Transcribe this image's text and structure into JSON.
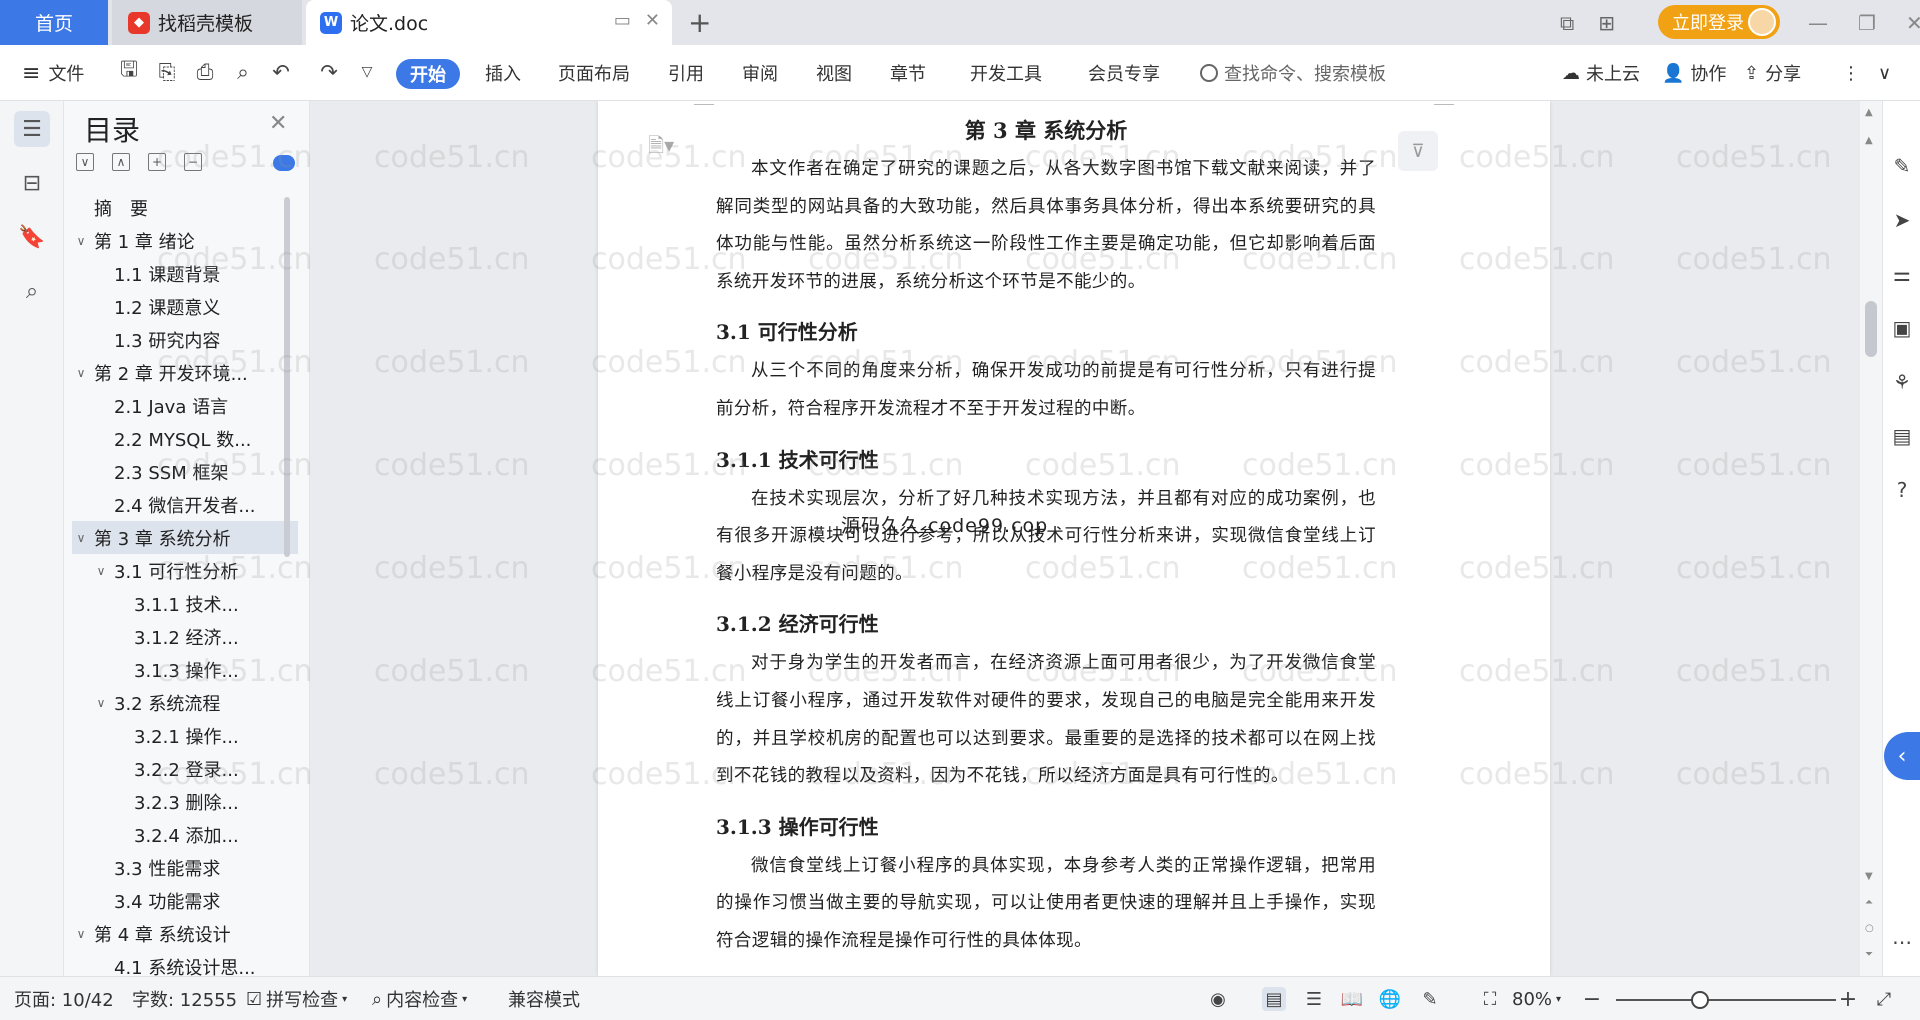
{
  "tabs": {
    "home": "首页",
    "daoke": "找稻壳模板",
    "doc": "论文.doc"
  },
  "account": {
    "login": "立即登录"
  },
  "ribbon": {
    "file": "文件",
    "tabs": [
      "开始",
      "插入",
      "页面布局",
      "引用",
      "审阅",
      "视图",
      "章节",
      "开发工具",
      "会员专享"
    ],
    "search_placeholder": "查找命令、搜索模板",
    "cloud": "未上云",
    "collab": "协作",
    "share": "分享"
  },
  "toc": {
    "title": "目录",
    "items": [
      {
        "label": "摘　要",
        "level": 0,
        "caret": ""
      },
      {
        "label": "第 1 章  绪论",
        "level": 0,
        "caret": "∨"
      },
      {
        "label": "1.1  课题背景",
        "level": 1,
        "caret": ""
      },
      {
        "label": "1.2  课题意义",
        "level": 1,
        "caret": ""
      },
      {
        "label": "1.3  研究内容",
        "level": 1,
        "caret": ""
      },
      {
        "label": "第 2 章  开发环境...",
        "level": 0,
        "caret": "∨"
      },
      {
        "label": "2.1 Java 语言",
        "level": 1,
        "caret": ""
      },
      {
        "label": "2.2 MYSQL 数...",
        "level": 1,
        "caret": ""
      },
      {
        "label": "2.3 SSM 框架",
        "level": 1,
        "caret": ""
      },
      {
        "label": "2.4 微信开发者...",
        "level": 1,
        "caret": ""
      },
      {
        "label": "第 3 章  系统分析",
        "level": 0,
        "caret": "∨",
        "selected": true
      },
      {
        "label": "3.1  可行性分析",
        "level": 1,
        "caret": "∨"
      },
      {
        "label": "3.1.1  技术...",
        "level": 2,
        "caret": ""
      },
      {
        "label": "3.1.2  经济...",
        "level": 2,
        "caret": ""
      },
      {
        "label": "3.1.3  操作...",
        "level": 2,
        "caret": ""
      },
      {
        "label": "3.2  系统流程",
        "level": 1,
        "caret": "∨"
      },
      {
        "label": "3.2.1  操作...",
        "level": 2,
        "caret": ""
      },
      {
        "label": "3.2.2  登录...",
        "level": 2,
        "caret": ""
      },
      {
        "label": "3.2.3  删除...",
        "level": 2,
        "caret": ""
      },
      {
        "label": "3.2.4  添加...",
        "level": 2,
        "caret": ""
      },
      {
        "label": "3.3  性能需求",
        "level": 1,
        "caret": ""
      },
      {
        "label": "3.4  功能需求",
        "level": 1,
        "caret": ""
      },
      {
        "label": "第 4 章  系统设计",
        "level": 0,
        "caret": "∨"
      },
      {
        "label": "4.1  系统设计思...",
        "level": 1,
        "caret": ""
      }
    ]
  },
  "document": {
    "chapter_title": "第 3 章  系统分析",
    "intro": "本文作者在确定了研究的课题之后，从各大数字图书馆下载文献来阅读，并了解同类型的网站具备的大致功能，然后具体事务具体分析，得出本系统要研究的具体功能与性能。虽然分析系统这一阶段性工作主要是确定功能，但它却影响着后面系统开发环节的进展，系统分析这个环节是不能少的。",
    "sec_3_1": "3.1  可行性分析",
    "sec_3_1_text": "从三个不同的角度来分析，确保开发成功的前提是有可行性分析，只有进行提前分析，符合程序开发流程才不至于开发过程的中断。",
    "sec_3_1_1": "3.1.1  技术可行性",
    "sec_3_1_1_text": "在技术实现层次，分析了好几种技术实现方法，并且都有对应的成功案例，也有很多开源模块可以进行参考，所以从技术可行性分析来讲，实现微信食堂线上订餐小程序是没有问题的。",
    "sec_3_1_2": "3.1.2  经济可行性",
    "sec_3_1_2_text": "对于身为学生的开发者而言，在经济资源上面可用者很少，为了开发微信食堂线上订餐小程序，通过开发软件对硬件的要求，发现自己的电脑是完全能用来开发的，并且学校机房的配置也可以达到要求。最重要的是选择的技术都可以在网上找到不花钱的教程以及资料，因为不花钱，所以经济方面是具有可行性的。",
    "sec_3_1_3": "3.1.3  操作可行性",
    "sec_3_1_3_text": "微信食堂线上订餐小程序的具体实现，本身参考人类的正常操作逻辑，把常用的操作习惯当做主要的导航实现，可以让使用者更快速的理解并且上手操作，实现符合逻辑的操作流程是操作可行性的具体体现。",
    "overlay": "源码久久 code99.cop",
    "watermark": "code51.cn"
  },
  "status": {
    "page": "页面: 10/42",
    "words": "字数: 12555",
    "spell": "拼写检查",
    "content_check": "内容检查",
    "compat": "兼容模式",
    "zoom": "80%",
    "zoom_fraction": 0.38
  },
  "colors": {
    "accent": "#3c79e6",
    "login": "#f1a114"
  }
}
